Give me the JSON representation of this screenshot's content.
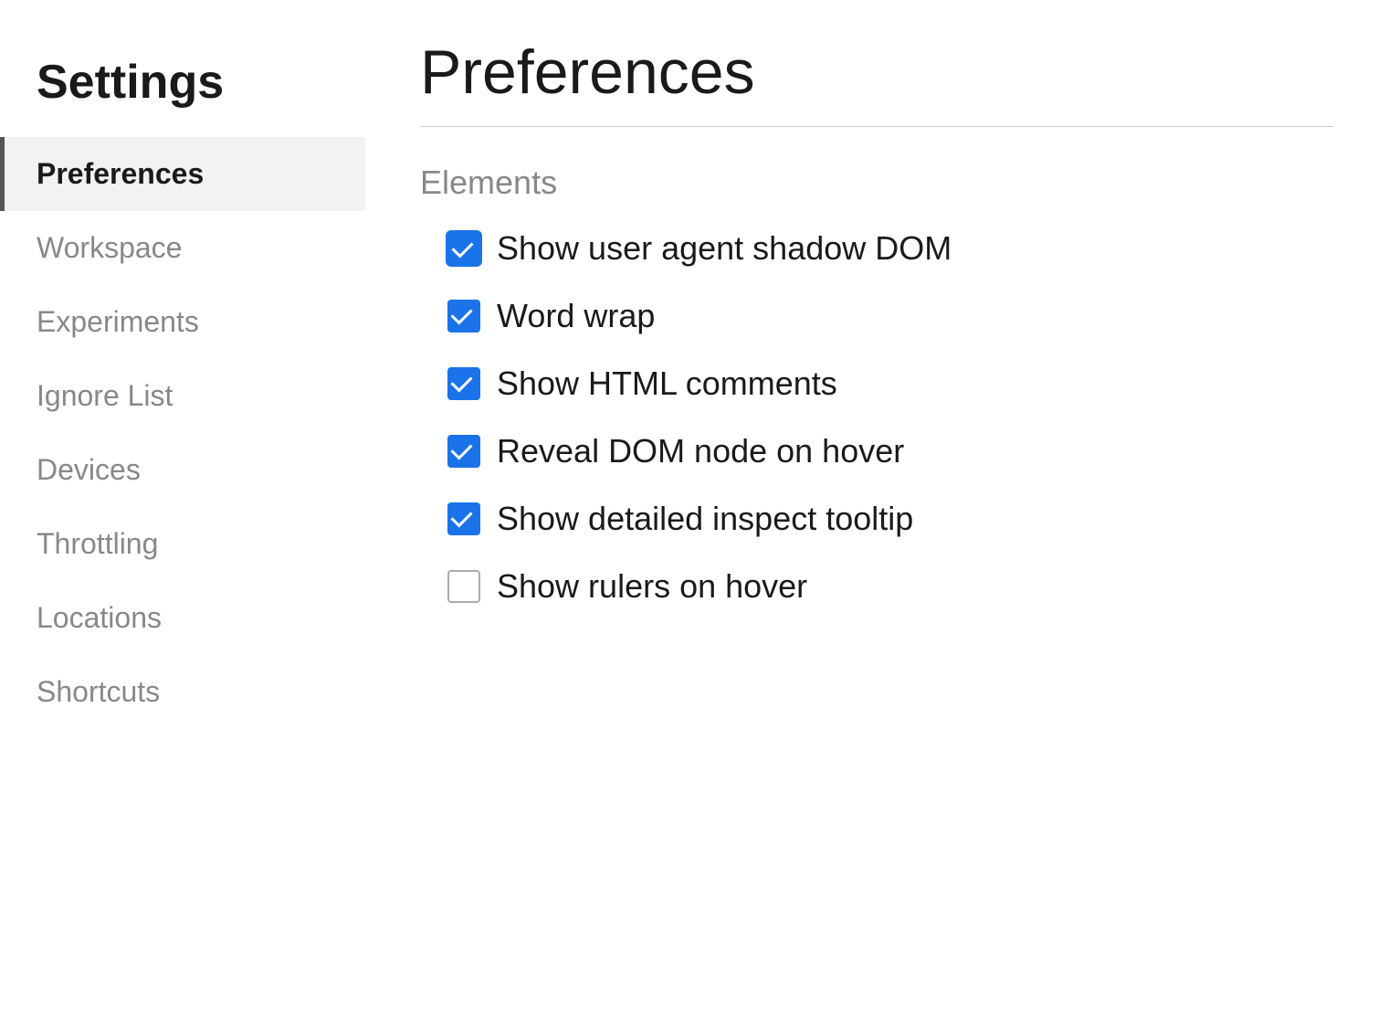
{
  "sidebar": {
    "title": "Settings",
    "items": [
      {
        "id": "preferences",
        "label": "Preferences",
        "active": true
      },
      {
        "id": "workspace",
        "label": "Workspace",
        "active": false
      },
      {
        "id": "experiments",
        "label": "Experiments",
        "active": false
      },
      {
        "id": "ignore-list",
        "label": "Ignore List",
        "active": false
      },
      {
        "id": "devices",
        "label": "Devices",
        "active": false
      },
      {
        "id": "throttling",
        "label": "Throttling",
        "active": false
      },
      {
        "id": "locations",
        "label": "Locations",
        "active": false
      },
      {
        "id": "shortcuts",
        "label": "Shortcuts",
        "active": false
      }
    ]
  },
  "main": {
    "page_title": "Preferences",
    "sections": [
      {
        "id": "elements",
        "title": "Elements",
        "checkboxes": [
          {
            "id": "shadow-dom",
            "label": "Show user agent shadow DOM",
            "checked": true
          },
          {
            "id": "word-wrap",
            "label": "Word wrap",
            "checked": true
          },
          {
            "id": "html-comments",
            "label": "Show HTML comments",
            "checked": true
          },
          {
            "id": "reveal-dom",
            "label": "Reveal DOM node on hover",
            "checked": true
          },
          {
            "id": "inspect-tooltip",
            "label": "Show detailed inspect tooltip",
            "checked": true
          },
          {
            "id": "rulers",
            "label": "Show rulers on hover",
            "checked": false
          }
        ]
      }
    ]
  }
}
